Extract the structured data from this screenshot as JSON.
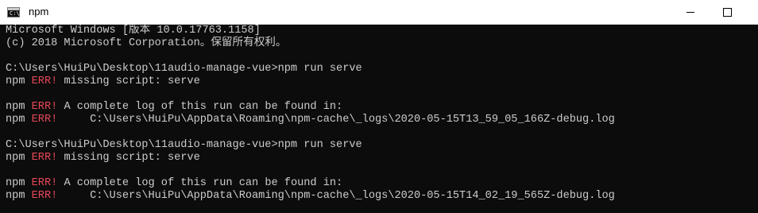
{
  "window": {
    "title": "npm",
    "icon": "console-icon",
    "icon_label": "C:\\",
    "controls": [
      "minimize-icon",
      "maximize-icon"
    ]
  },
  "colors": {
    "background": "#0c0c0c",
    "text": "#cccccc",
    "error": "#e74856",
    "titlebar": "#ffffff"
  },
  "console": {
    "version_line": "Microsoft Windows [版本 10.0.17763.1158]",
    "copyright_line": "(c) 2018 Microsoft Corporation。保留所有权利。",
    "sessions": [
      {
        "prompt": "C:\\Users\\HuiPu\\Desktop\\11audio-manage-vue>npm run serve",
        "err1_prefix": "npm ",
        "err1_tag": "ERR!",
        "err1_text": " missing script: serve",
        "err2_prefix": "npm ",
        "err2_tag": "ERR!",
        "err2_text": " A complete log of this run can be found in:",
        "err3_prefix": "npm ",
        "err3_tag": "ERR!",
        "err3_text": "     C:\\Users\\HuiPu\\AppData\\Roaming\\npm-cache\\_logs\\2020-05-15T13_59_05_166Z-debug.log"
      },
      {
        "prompt": "C:\\Users\\HuiPu\\Desktop\\11audio-manage-vue>npm run serve",
        "err1_prefix": "npm ",
        "err1_tag": "ERR!",
        "err1_text": " missing script: serve",
        "err2_prefix": "npm ",
        "err2_tag": "ERR!",
        "err2_text": " A complete log of this run can be found in:",
        "err3_prefix": "npm ",
        "err3_tag": "ERR!",
        "err3_text": "     C:\\Users\\HuiPu\\AppData\\Roaming\\npm-cache\\_logs\\2020-05-15T14_02_19_565Z-debug.log"
      }
    ]
  }
}
